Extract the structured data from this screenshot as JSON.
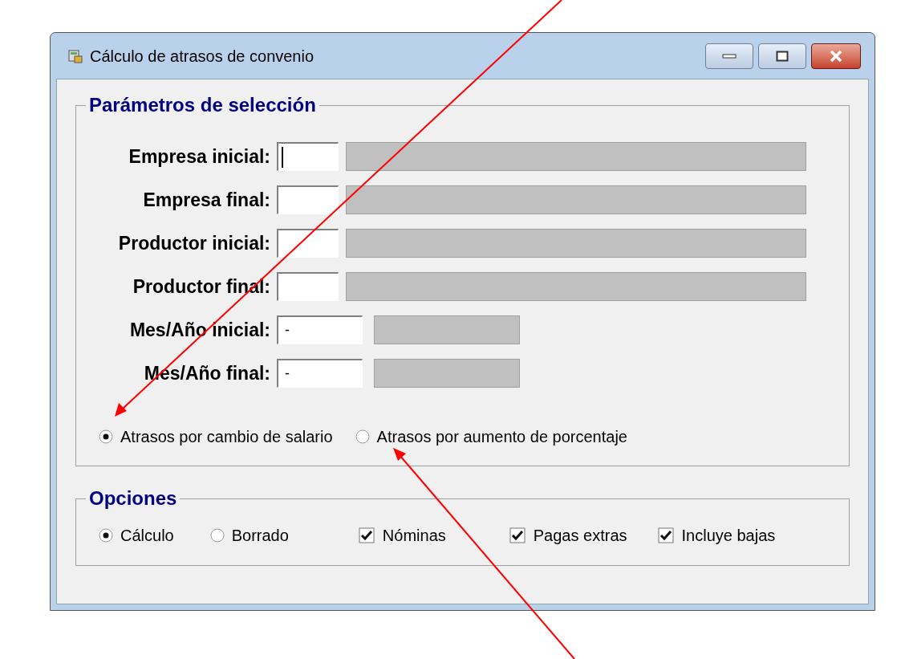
{
  "window": {
    "title": "Cálculo de atrasos de convenio"
  },
  "selection": {
    "title": "Parámetros de selección",
    "fields": [
      {
        "label": "Empresa inicial:",
        "kind": "code",
        "focused": true
      },
      {
        "label": "Empresa final:",
        "kind": "code",
        "focused": false
      },
      {
        "label": "Productor inicial:",
        "kind": "code",
        "focused": false
      },
      {
        "label": "Productor final:",
        "kind": "code",
        "focused": false
      },
      {
        "label": "Mes/Año inicial:",
        "kind": "period",
        "value": "-",
        "focused": false
      },
      {
        "label": "Mes/Año final:",
        "kind": "period",
        "value": "-",
        "focused": false
      }
    ],
    "arrears_types": [
      {
        "label": "Atrasos por cambio de salario",
        "selected": true
      },
      {
        "label": "Atrasos por aumento de porcentaje",
        "selected": false
      }
    ]
  },
  "options": {
    "title": "Opciones",
    "modes": [
      {
        "label": "Cálculo",
        "selected": true
      },
      {
        "label": "Borrado",
        "selected": false
      }
    ],
    "checks": [
      {
        "label": "Nóminas",
        "checked": true
      },
      {
        "label": "Pagas extras",
        "checked": true
      },
      {
        "label": "Incluye bajas",
        "checked": true
      }
    ]
  }
}
